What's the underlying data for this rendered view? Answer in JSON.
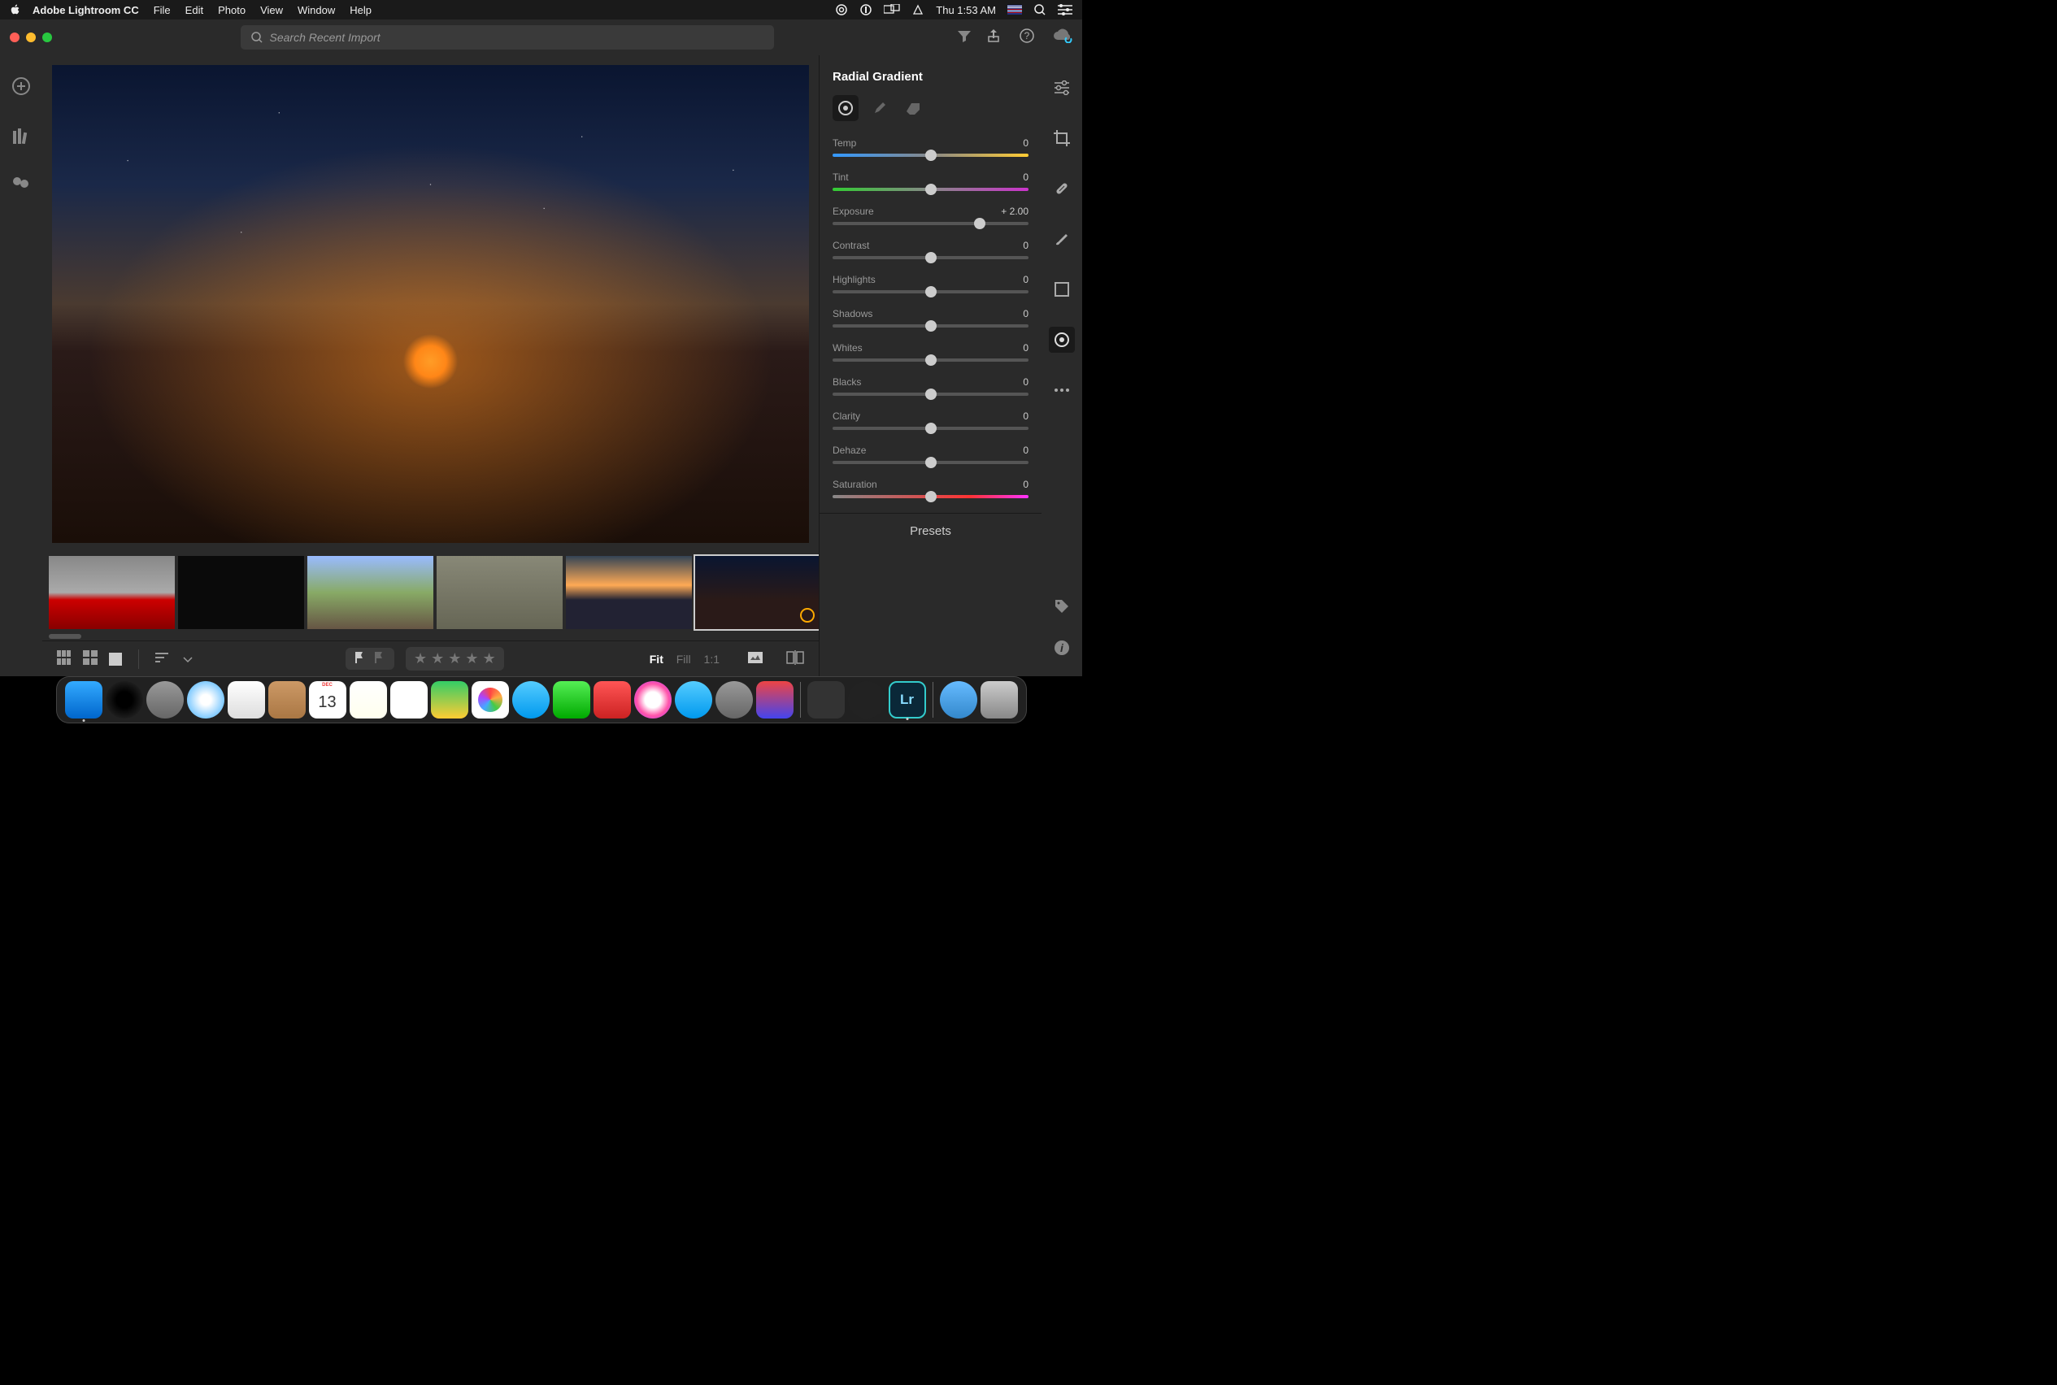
{
  "menubar": {
    "app_name": "Adobe Lightroom CC",
    "items": [
      "File",
      "Edit",
      "Photo",
      "View",
      "Window",
      "Help"
    ],
    "clock": "Thu 1:53 AM"
  },
  "toolbar": {
    "search_placeholder": "Search Recent Import"
  },
  "panel": {
    "title": "Radial Gradient",
    "sliders": [
      {
        "label": "Temp",
        "value": "0",
        "pos": 50,
        "track": "tr-temp"
      },
      {
        "label": "Tint",
        "value": "0",
        "pos": 50,
        "track": "tr-tint"
      },
      {
        "label": "Exposure",
        "value": "+ 2.00",
        "pos": 75,
        "track": "tr-neutral"
      },
      {
        "label": "Contrast",
        "value": "0",
        "pos": 50,
        "track": "tr-neutral"
      },
      {
        "label": "Highlights",
        "value": "0",
        "pos": 50,
        "track": "tr-neutral"
      },
      {
        "label": "Shadows",
        "value": "0",
        "pos": 50,
        "track": "tr-neutral"
      },
      {
        "label": "Whites",
        "value": "0",
        "pos": 50,
        "track": "tr-neutral"
      },
      {
        "label": "Blacks",
        "value": "0",
        "pos": 50,
        "track": "tr-neutral"
      },
      {
        "label": "Clarity",
        "value": "0",
        "pos": 50,
        "track": "tr-neutral"
      },
      {
        "label": "Dehaze",
        "value": "0",
        "pos": 50,
        "track": "tr-neutral"
      },
      {
        "label": "Saturation",
        "value": "0",
        "pos": 50,
        "track": "tr-sat"
      }
    ],
    "presets_label": "Presets"
  },
  "bottombar": {
    "fit": "Fit",
    "fill": "Fill",
    "ratio": "1:1"
  },
  "calendar_day": "13"
}
